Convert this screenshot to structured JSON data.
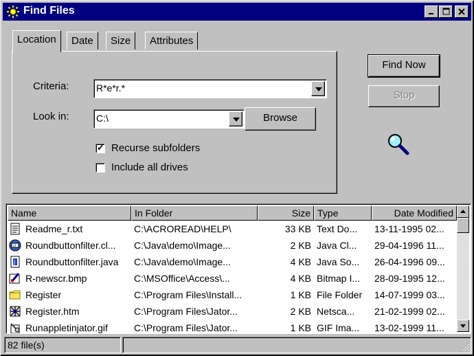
{
  "window": {
    "title": "Find Files"
  },
  "tabs": [
    {
      "label": "Location",
      "active": true
    },
    {
      "label": "Date",
      "active": false
    },
    {
      "label": "Size",
      "active": false
    },
    {
      "label": "Attributes",
      "active": false
    }
  ],
  "location": {
    "criteria_label": "Criteria:",
    "criteria_value": "R*e*r.*",
    "lookin_label": "Look in:",
    "lookin_value": "C:\\",
    "browse_label": "Browse",
    "recurse_label": "Recurse subfolders",
    "recurse_checked": true,
    "alldrives_label": "Include all drives",
    "alldrives_checked": false
  },
  "buttons": {
    "find_now": "Find Now",
    "stop": "Stop"
  },
  "list": {
    "columns": {
      "name": "Name",
      "folder": "In Folder",
      "size": "Size",
      "type": "Type",
      "modified": "Date Modified"
    },
    "rows": [
      {
        "name": "Readme_r.txt",
        "folder": "C:\\ACROREAD\\HELP\\",
        "size": "33 KB",
        "type": "Text Do...",
        "modified": "13-11-1995 02...",
        "icon": "text-file-icon"
      },
      {
        "name": "Roundbuttonfilter.cl...",
        "folder": "C:\\Java\\demo\\Image...",
        "size": "2 KB",
        "type": "Java Cl...",
        "modified": "29-04-1996 11...",
        "icon": "java-class-icon"
      },
      {
        "name": "Roundbuttonfilter.java",
        "folder": "C:\\Java\\demo\\Image...",
        "size": "4 KB",
        "type": "Java So...",
        "modified": "26-04-1996 09...",
        "icon": "java-source-icon"
      },
      {
        "name": "R-newscr.bmp",
        "folder": "C:\\MSOffice\\Access\\...",
        "size": "4 KB",
        "type": "Bitmap I...",
        "modified": "28-09-1995 12...",
        "icon": "paint-bitmap-icon"
      },
      {
        "name": "Register",
        "folder": "C:\\Program Files\\Install...",
        "size": "1 KB",
        "type": "File Folder",
        "modified": "14-07-1999 03...",
        "icon": "folder-icon"
      },
      {
        "name": "Register.htm",
        "folder": "C:\\Program Files\\Jator...",
        "size": "2 KB",
        "type": "Netsca...",
        "modified": "21-02-1999 02...",
        "icon": "html-file-icon"
      },
      {
        "name": "Runappletinjator.gif",
        "folder": "C:\\Program Files\\Jator...",
        "size": "1 KB",
        "type": "GIF Ima...",
        "modified": "13-02-1999 11...",
        "icon": "gif-image-icon"
      }
    ]
  },
  "status": {
    "count": "82 file(s)"
  },
  "colors": {
    "titlebar": "#000080",
    "face": "#c0c0c0",
    "shadow": "#808080"
  }
}
